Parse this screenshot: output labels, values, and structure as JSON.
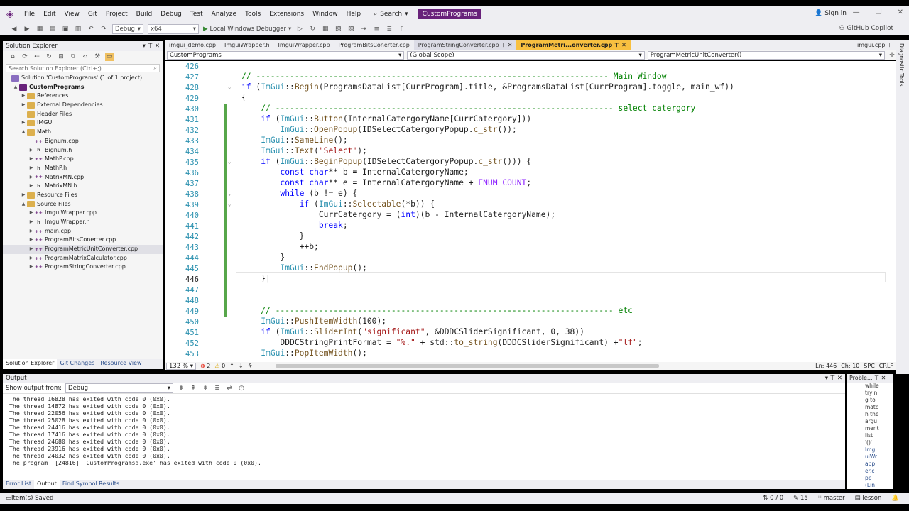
{
  "menu": {
    "items": [
      "File",
      "Edit",
      "View",
      "Git",
      "Project",
      "Build",
      "Debug",
      "Test",
      "Analyze",
      "Tools",
      "Extensions",
      "Window",
      "Help"
    ],
    "search_label": "Search",
    "solution_name": "CustomPrograms",
    "sign_in": "Sign in"
  },
  "toolbar": {
    "config": "Debug",
    "platform": "x64",
    "run_label": "Local Windows Debugger",
    "copilot": "GitHub Copilot"
  },
  "solution_explorer": {
    "title": "Solution Explorer",
    "search_placeholder": "Search Solution Explorer (Ctrl+;)",
    "items": [
      {
        "label": "Solution 'CustomPrograms' (1 of 1 project)",
        "indent": 0,
        "icon": "sol",
        "exp": ""
      },
      {
        "label": "CustomPrograms",
        "indent": 1,
        "icon": "proj",
        "exp": "▲",
        "bold": true
      },
      {
        "label": "References",
        "indent": 2,
        "icon": "folder",
        "exp": "▶"
      },
      {
        "label": "External Dependencies",
        "indent": 2,
        "icon": "folder",
        "exp": "▶"
      },
      {
        "label": "Header Files",
        "indent": 2,
        "icon": "folder",
        "exp": ""
      },
      {
        "label": "IMGUI",
        "indent": 2,
        "icon": "folder",
        "exp": "▶"
      },
      {
        "label": "Math",
        "indent": 2,
        "icon": "folder",
        "exp": "▲"
      },
      {
        "label": "Bignum.cpp",
        "indent": 3,
        "icon": "cpp",
        "exp": ""
      },
      {
        "label": "Bignum.h",
        "indent": 3,
        "icon": "h",
        "exp": "▶"
      },
      {
        "label": "MathP.cpp",
        "indent": 3,
        "icon": "cpp",
        "exp": "▶"
      },
      {
        "label": "MathP.h",
        "indent": 3,
        "icon": "h",
        "exp": "▶"
      },
      {
        "label": "MatrixMN.cpp",
        "indent": 3,
        "icon": "cpp",
        "exp": "▶"
      },
      {
        "label": "MatrixMN.h",
        "indent": 3,
        "icon": "h",
        "exp": "▶"
      },
      {
        "label": "Resource Files",
        "indent": 2,
        "icon": "folder",
        "exp": "▶"
      },
      {
        "label": "Source Files",
        "indent": 2,
        "icon": "folder",
        "exp": "▲"
      },
      {
        "label": "ImguiWrapper.cpp",
        "indent": 3,
        "icon": "cpp",
        "exp": "▶"
      },
      {
        "label": "ImguiWrapper.h",
        "indent": 3,
        "icon": "h",
        "exp": "▶"
      },
      {
        "label": "main.cpp",
        "indent": 3,
        "icon": "cpp",
        "exp": "▶"
      },
      {
        "label": "ProgramBitsConerter.cpp",
        "indent": 3,
        "icon": "cpp",
        "exp": "▶"
      },
      {
        "label": "ProgramMetricUnitConverter.cpp",
        "indent": 3,
        "icon": "cpp",
        "exp": "▶",
        "selected": true
      },
      {
        "label": "ProgramMatrixCalculator.cpp",
        "indent": 3,
        "icon": "cpp",
        "exp": "▶"
      },
      {
        "label": "ProgramStringConverter.cpp",
        "indent": 3,
        "icon": "cpp",
        "exp": "▶"
      }
    ],
    "bottom_tabs": [
      "Solution Explorer",
      "Git Changes",
      "Resource View"
    ]
  },
  "editor": {
    "tabs": [
      "imgui_demo.cpp",
      "ImguiWrapper.h",
      "ImguiWrapper.cpp",
      "ProgramBitsConerter.cpp",
      "ProgramStringConverter.cpp",
      "ProgramMetri...onverter.cpp"
    ],
    "right_tab": "imgui.cpp",
    "nav_project": "CustomPrograms",
    "nav_scope": "(Global Scope)",
    "nav_member": "ProgramMetricUnitConverter()",
    "zoom": "132 %",
    "errors": "2",
    "warnings": "0",
    "position": "Ln: 446",
    "column": "Ch: 10",
    "spc": "SPC",
    "crlf": "CRLF",
    "line_numbers": [
      "426",
      "427",
      "428",
      "429",
      "430",
      "431",
      "432",
      "433",
      "434",
      "435",
      "436",
      "437",
      "438",
      "439",
      "440",
      "441",
      "442",
      "443",
      "444",
      "445",
      "446",
      "447",
      "448",
      "449",
      "450",
      "451",
      "452",
      "453"
    ]
  },
  "output": {
    "title": "Output",
    "show_from_label": "Show output from:",
    "source": "Debug",
    "lines": [
      "The thread 16828 has exited with code 0 (0x0).",
      "The thread 14872 has exited with code 0 (0x0).",
      "The thread 22056 has exited with code 0 (0x0).",
      "The thread 25028 has exited with code 0 (0x0).",
      "The thread 24416 has exited with code 0 (0x0).",
      "The thread 17416 has exited with code 0 (0x0).",
      "The thread 24680 has exited with code 0 (0x0).",
      "The thread 23916 has exited with code 0 (0x0).",
      "The thread 24032 has exited with code 0 (0x0).",
      "The program '[24816]  CustomProgramsd.exe' has exited with code 0 (0x0)."
    ],
    "tabs": [
      "Error List",
      "Output",
      "Find Symbol Results"
    ]
  },
  "problems": {
    "title": "Proble...",
    "lines": [
      "while",
      "tryin",
      "g to",
      "matc",
      "h the",
      "argu",
      "ment",
      "list",
      "'()'"
    ],
    "links": [
      "Img",
      "uiWr",
      "app",
      "er.c",
      "pp",
      "(Lin"
    ]
  },
  "statusbar": {
    "left": "Item(s) Saved",
    "updown": "0 / 0",
    "pencil": "15",
    "branch": "master",
    "repo": "lesson"
  }
}
